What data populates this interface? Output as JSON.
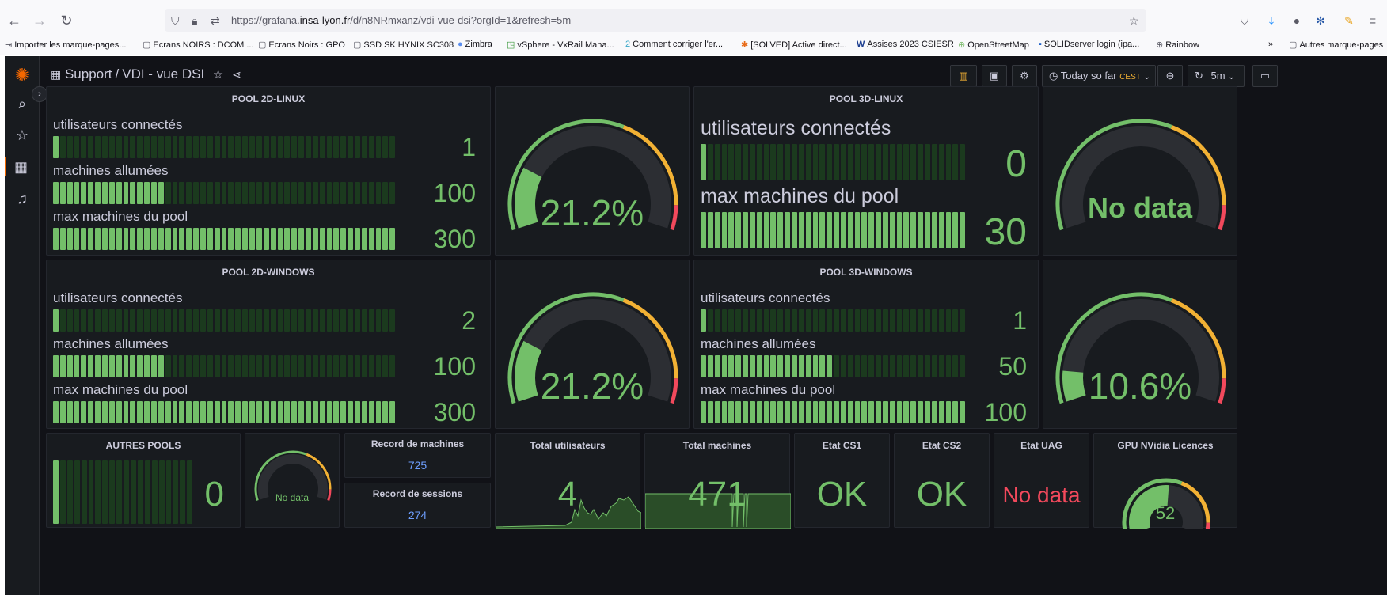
{
  "browser": {
    "url_pre": "https://grafana.",
    "url_host": "insa-lyon.fr",
    "url_post": "/d/n8NRmxanz/vdi-vue-dsi?orgId=1&refresh=5m",
    "bookmarks": [
      {
        "icon": "⇥",
        "label": "Importer les marque-pages..."
      },
      {
        "icon": "▢",
        "label": "Ecrans NOIRS : DCOM ..."
      },
      {
        "icon": "▢",
        "label": "Ecrans Noirs : GPO"
      },
      {
        "icon": "▢",
        "label": "SSD SK HYNIX SC308"
      },
      {
        "icon": "●",
        "label": "Zimbra"
      },
      {
        "icon": "◳",
        "label": "vSphere - VxRail Mana..."
      },
      {
        "icon": "2",
        "label": "Comment corriger l'er..."
      },
      {
        "icon": "✱",
        "label": "[SOLVED] Active direct..."
      },
      {
        "icon": "W",
        "label": "Assises 2023 CSIESR"
      },
      {
        "icon": "⊕",
        "label": "OpenStreetMap"
      },
      {
        "icon": "▪",
        "label": "SOLIDserver login (ipa..."
      },
      {
        "icon": "⊕",
        "label": "Rainbow"
      }
    ],
    "more_bookmarks": "Autres marque-pages"
  },
  "dashboard": {
    "folder": "Support",
    "title": "VDI - vue DSI",
    "time_range": "Today so far",
    "timezone": "CEST",
    "refresh": "5m"
  },
  "panels": {
    "p2dl": {
      "title": "POOL 2D-LINUX",
      "rows": [
        {
          "label": "utilisateurs connectés",
          "value": "1",
          "fill": 0.0033
        },
        {
          "label": "machines allumées",
          "value": "100",
          "fill": 0.333
        },
        {
          "label": "max machines du pool",
          "value": "300",
          "fill": 1
        }
      ]
    },
    "g2dl": {
      "value": "21.2%",
      "fraction": 0.212
    },
    "p3dl": {
      "title": "POOL 3D-LINUX",
      "rows": [
        {
          "label": "utilisateurs connectés",
          "value": "0",
          "fill": 0
        },
        {
          "label": "max machines du pool",
          "value": "30",
          "fill": 1
        }
      ]
    },
    "g3dl": {
      "value": "No data",
      "fraction": 0
    },
    "p2dw": {
      "title": "POOL 2D-WINDOWS",
      "rows": [
        {
          "label": "utilisateurs connectés",
          "value": "2",
          "fill": 0.0067
        },
        {
          "label": "machines allumées",
          "value": "100",
          "fill": 0.333
        },
        {
          "label": "max machines du pool",
          "value": "300",
          "fill": 1
        }
      ]
    },
    "g2dw": {
      "value": "21.2%",
      "fraction": 0.212
    },
    "p3dw": {
      "title": "POOL 3D-WINDOWS",
      "rows": [
        {
          "label": "utilisateurs connectés",
          "value": "1",
          "fill": 0.01
        },
        {
          "label": "machines allumées",
          "value": "50",
          "fill": 0.5
        },
        {
          "label": "max machines du pool",
          "value": "100",
          "fill": 1
        }
      ]
    },
    "g3dw": {
      "value": "10.6%",
      "fraction": 0.106
    },
    "autres": {
      "title": "AUTRES POOLS",
      "value": "0",
      "fill": 0
    },
    "gautres": {
      "value": "No data",
      "fraction": 0
    },
    "record_machines": {
      "title": "Record de machines",
      "value": "725"
    },
    "record_sessions": {
      "title": "Record de sessions",
      "value": "274"
    },
    "total_users": {
      "title": "Total utilisateurs",
      "value": "4"
    },
    "total_machines": {
      "title": "Total machines",
      "value": "471"
    },
    "cs1": {
      "title": "Etat CS1",
      "value": "OK"
    },
    "cs2": {
      "title": "Etat CS2",
      "value": "OK"
    },
    "uag": {
      "title": "Etat UAG",
      "value": "No data"
    },
    "gpu": {
      "title": "GPU NVidia Licences",
      "value": "52",
      "fraction": 0.52
    }
  },
  "colors": {
    "green": "#73bf69",
    "yellow": "#fade2a",
    "orange": "#f2b134",
    "red": "#f2495c",
    "track": "#2c2e33",
    "blue": "#6e9fff"
  }
}
